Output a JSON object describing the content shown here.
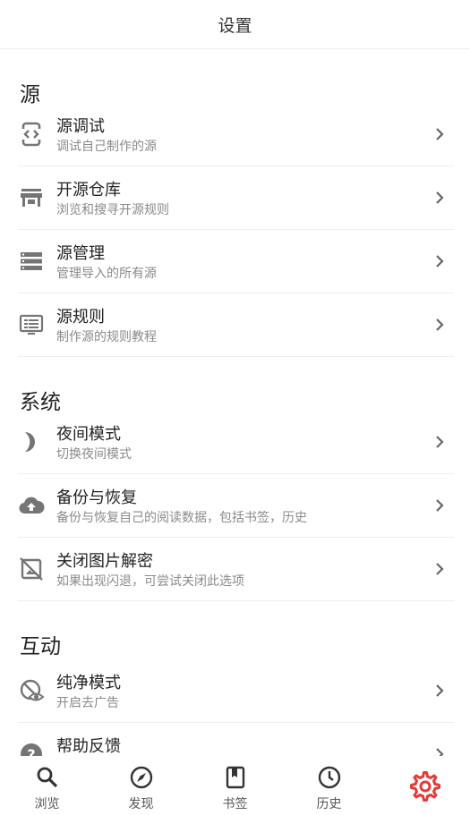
{
  "header": {
    "title": "设置"
  },
  "sections": {
    "source": {
      "title": "源",
      "items": [
        {
          "title": "源调试",
          "subtitle": "调试自己制作的源",
          "icon": "code-debug-icon"
        },
        {
          "title": "开源仓库",
          "subtitle": "浏览和搜寻开源规则",
          "icon": "store-icon"
        },
        {
          "title": "源管理",
          "subtitle": "管理导入的所有源",
          "icon": "storage-list-icon"
        },
        {
          "title": "源规则",
          "subtitle": "制作源的规则教程",
          "icon": "monitor-text-icon"
        }
      ]
    },
    "system": {
      "title": "系统",
      "items": [
        {
          "title": "夜间模式",
          "subtitle": "切换夜间模式",
          "icon": "half-moon-icon"
        },
        {
          "title": "备份与恢复",
          "subtitle": "备份与恢复自己的阅读数据，包括书签，历史",
          "icon": "cloud-upload-icon"
        },
        {
          "title": "关闭图片解密",
          "subtitle": "如果出现闪退，可尝试关闭此选项",
          "icon": "image-off-icon"
        }
      ]
    },
    "interact": {
      "title": "互动",
      "items": [
        {
          "title": "纯净模式",
          "subtitle": "开启去广告",
          "icon": "eye-shield-icon"
        },
        {
          "title": "帮助反馈",
          "subtitle": "",
          "icon": "help-circle-icon"
        }
      ]
    }
  },
  "bottom_nav": [
    {
      "label": "浏览",
      "icon": "search-icon"
    },
    {
      "label": "发现",
      "icon": "compass-icon"
    },
    {
      "label": "书签",
      "icon": "bookmark-icon"
    },
    {
      "label": "历史",
      "icon": "clock-icon"
    },
    {
      "label": "",
      "icon": "gear-icon",
      "active": true
    }
  ],
  "colors": {
    "accent": "#e53935",
    "icon_gray": "#757575",
    "divider": "#eeeeee"
  }
}
